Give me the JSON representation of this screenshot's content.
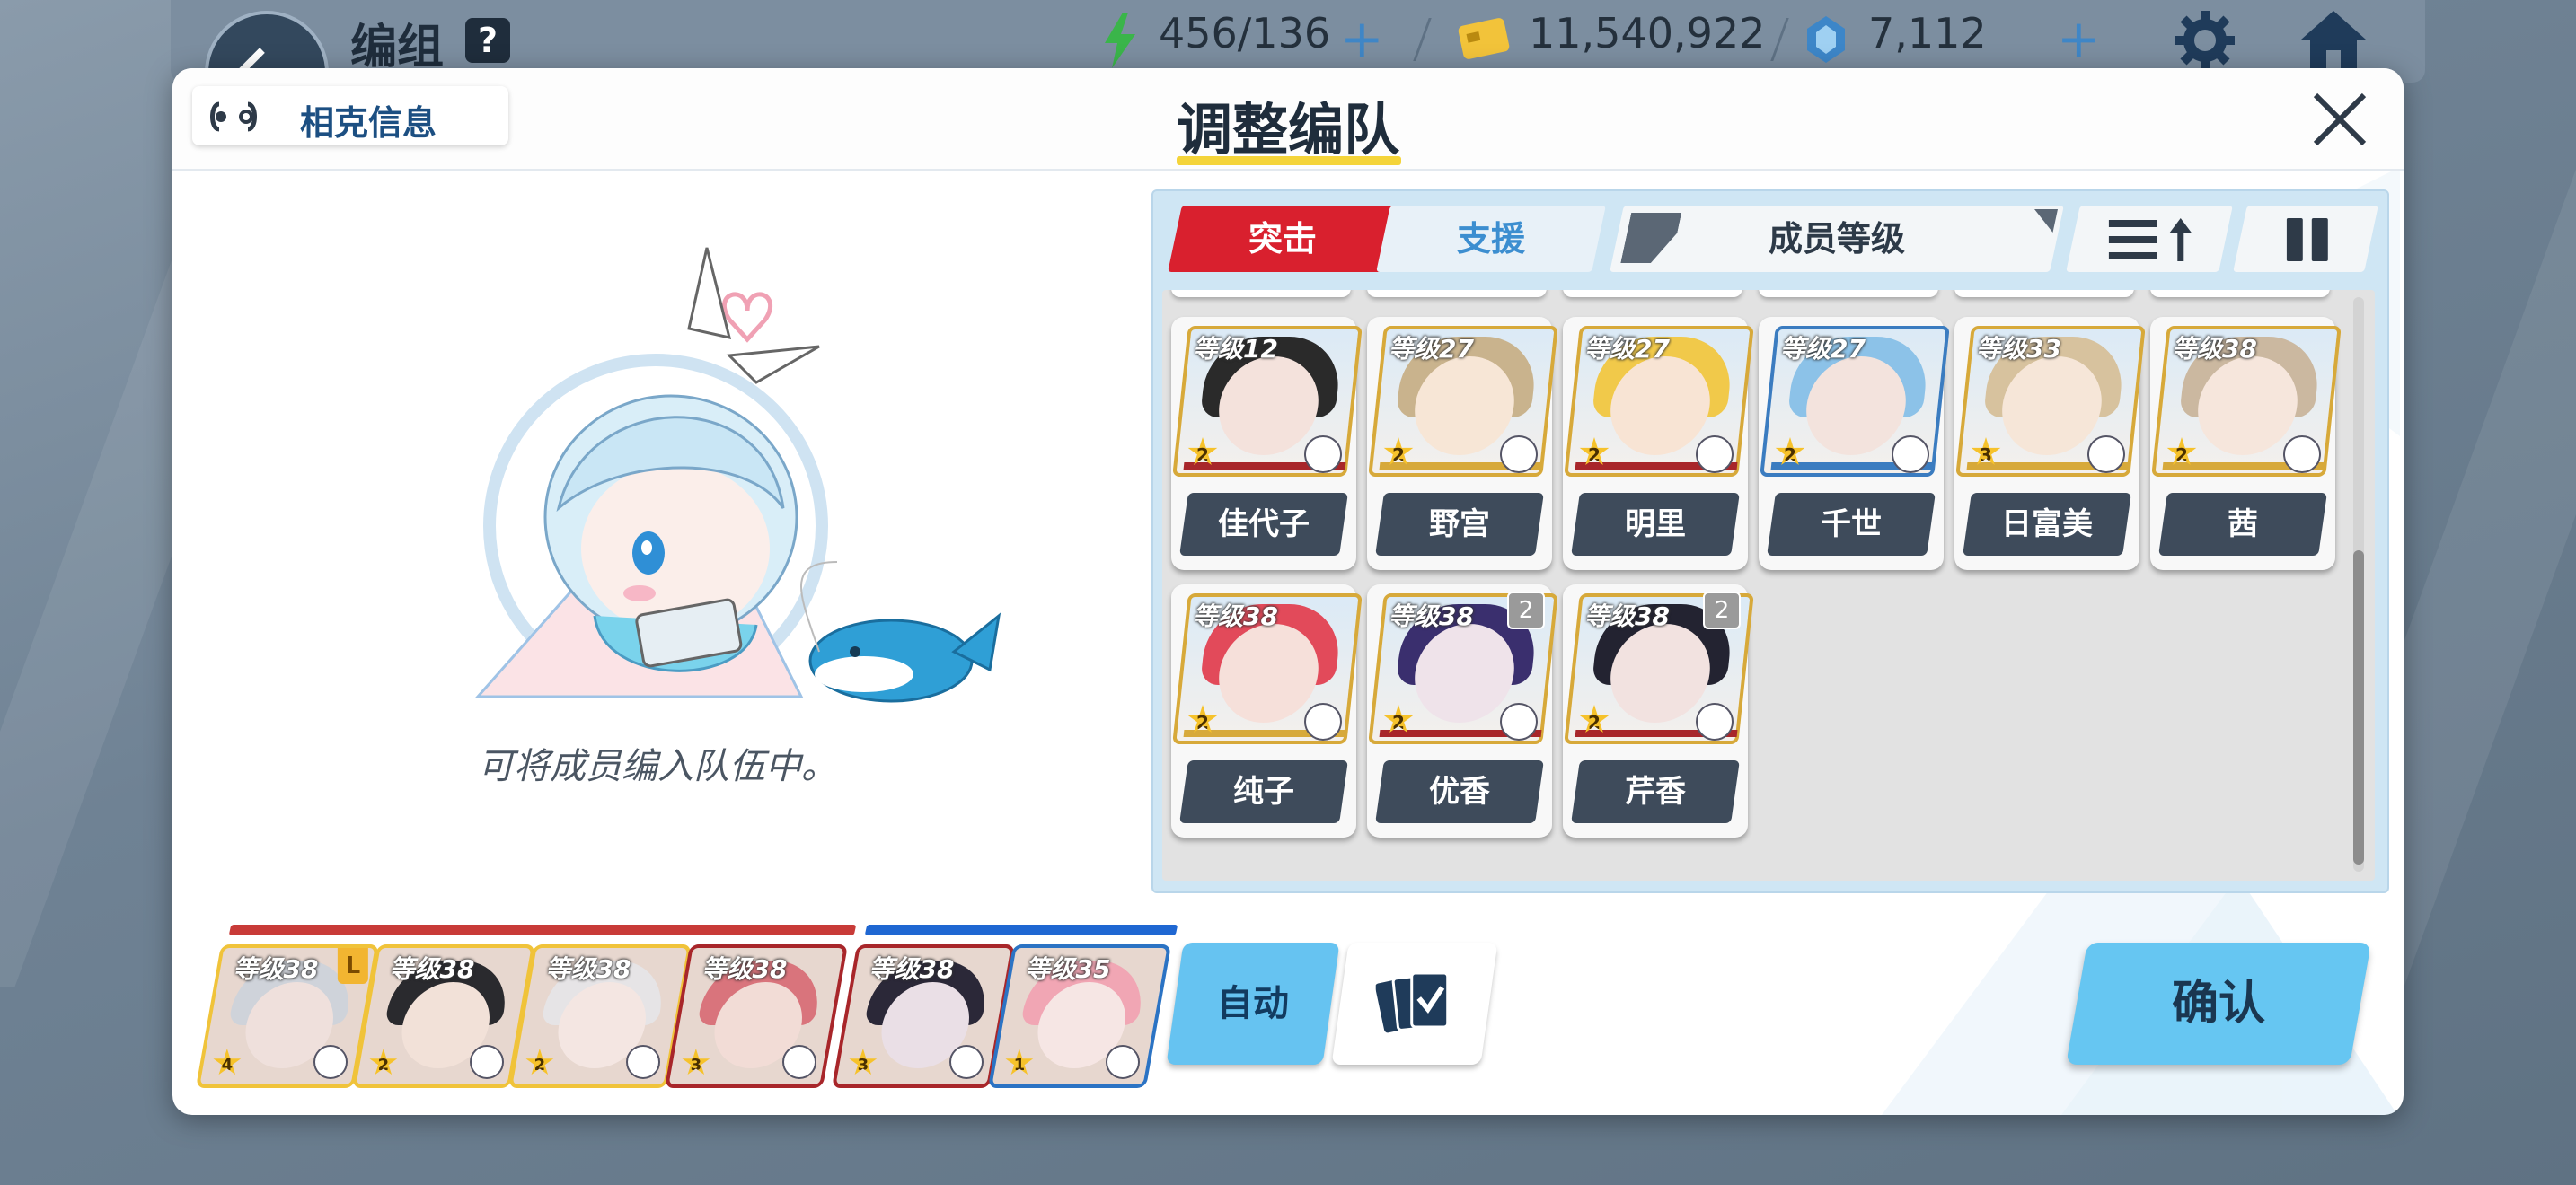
{
  "topbar": {
    "title": "编组",
    "help": "?",
    "stamina": "456/136",
    "credits": "11,540,922",
    "gems": "7,112"
  },
  "modal": {
    "counter_info": "相克信息",
    "title": "调整编队",
    "empty_hint": "可将成员编入队伍中。"
  },
  "tabs": {
    "assault": "突击",
    "support": "支援"
  },
  "filter": {
    "label": "成员等级"
  },
  "roster": [
    {
      "level": "等级12",
      "star": "2",
      "name": "佳代子",
      "frame": "gold",
      "skin": "#f4e2dc",
      "hair": "#2a2a2a",
      "bar": "#a8262a"
    },
    {
      "level": "等级27",
      "star": "2",
      "name": "野宫",
      "frame": "gold",
      "skin": "#f7e6d6",
      "hair": "#c9b38d",
      "bar": "#d7a93a"
    },
    {
      "level": "等级27",
      "star": "2",
      "name": "明里",
      "frame": "gold",
      "skin": "#f8e4d4",
      "hair": "#f1c94a",
      "bar": "#a8262a"
    },
    {
      "level": "等级27",
      "star": "2",
      "name": "千世",
      "frame": "blue",
      "skin": "#f3e3dd",
      "hair": "#8cc2e8",
      "bar": "#3b7cc0"
    },
    {
      "level": "等级33",
      "star": "3",
      "name": "日富美",
      "frame": "gold",
      "skin": "#f6e6d8",
      "hair": "#d7c29e",
      "bar": "#d7a93a"
    },
    {
      "level": "等级38",
      "star": "2",
      "name": "茜",
      "frame": "gold",
      "skin": "#f6e6dc",
      "hair": "#cbb8a0",
      "bar": "#d7a93a"
    },
    {
      "level": "等级38",
      "star": "2",
      "name": "纯子",
      "frame": "gold",
      "skin": "#f6e0da",
      "hair": "#e24a5a",
      "bar": "#d7a93a"
    },
    {
      "level": "等级38",
      "star": "2",
      "name": "优香",
      "frame": "gold",
      "skin": "#efe3ea",
      "hair": "#3a2f6e",
      "bar": "#a8262a",
      "badge": "2"
    },
    {
      "level": "等级38",
      "star": "2",
      "name": "芹香",
      "frame": "gold",
      "skin": "#f2e2e0",
      "hair": "#232331",
      "bar": "#a8262a",
      "badge": "2"
    }
  ],
  "team": [
    {
      "level": "等级38",
      "star": "4",
      "frame": "gold",
      "skin": "#efe0dc",
      "hair": "#cfd3da",
      "leader": "L"
    },
    {
      "level": "等级38",
      "star": "2",
      "frame": "gold",
      "skin": "#f2e1d8",
      "hair": "#2a2a2e"
    },
    {
      "level": "等级38",
      "star": "2",
      "frame": "gold",
      "skin": "#f4e6e2",
      "hair": "#e6e4e6"
    },
    {
      "level": "等级38",
      "star": "3",
      "frame": "red",
      "skin": "#f2dcd6",
      "hair": "#d9747c"
    },
    {
      "level": "等级38",
      "star": "3",
      "frame": "red",
      "skin": "#eadfe6",
      "hair": "#2b2838"
    },
    {
      "level": "等级35",
      "star": "1",
      "frame": "blue",
      "skin": "#f6e6e4",
      "hair": "#f1a6b4"
    }
  ],
  "buttons": {
    "auto": "自动",
    "confirm": "确认"
  },
  "colors": {
    "assault_red": "#d9202e",
    "support_blue": "#3c8ed0",
    "confirm_bg": "#66c6f2",
    "name_plate": "#3e4b5b"
  }
}
